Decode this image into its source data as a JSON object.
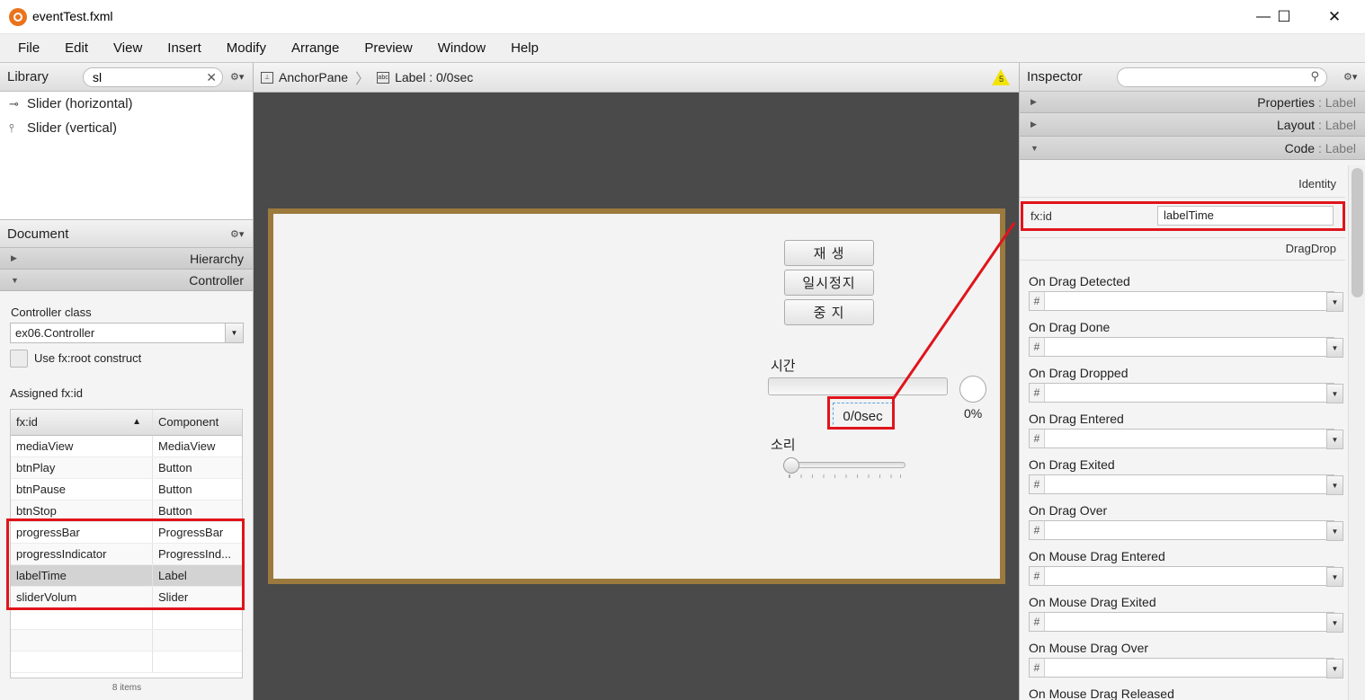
{
  "window": {
    "title": "eventTest.fxml",
    "minimize": "—",
    "maximize": "☐",
    "close": "✕"
  },
  "menu": [
    "File",
    "Edit",
    "View",
    "Insert",
    "Modify",
    "Arrange",
    "Preview",
    "Window",
    "Help"
  ],
  "library": {
    "title": "Library",
    "search_value": "sl",
    "items": [
      {
        "icon": "⊸",
        "label": "Slider  (horizontal)"
      },
      {
        "icon": "⫯",
        "label": "Slider  (vertical)"
      }
    ]
  },
  "document": {
    "title": "Document",
    "sections": {
      "hierarchy": "Hierarchy",
      "controller": "Controller"
    },
    "controller_class_label": "Controller class",
    "controller_class_value": "ex06.Controller",
    "use_root_label": "Use fx:root construct",
    "assigned_label": "Assigned fx:id",
    "columns": [
      "fx:id",
      "Component"
    ],
    "rows": [
      {
        "fxid": "mediaView",
        "component": "MediaView"
      },
      {
        "fxid": "btnPlay",
        "component": "Button"
      },
      {
        "fxid": "btnPause",
        "component": "Button"
      },
      {
        "fxid": "btnStop",
        "component": "Button"
      },
      {
        "fxid": "progressBar",
        "component": "ProgressBar"
      },
      {
        "fxid": "progressIndicator",
        "component": "ProgressInd..."
      },
      {
        "fxid": "labelTime",
        "component": "Label"
      },
      {
        "fxid": "sliderVolum",
        "component": "Slider"
      }
    ],
    "count": "8 items"
  },
  "breadcrumb": {
    "root": "AnchorPane",
    "current": "Label : 0/0sec",
    "warning_count": "5"
  },
  "canvas": {
    "btn_play": "재    생",
    "btn_pause": "일시정지",
    "btn_stop": "중    지",
    "time_label": "시간",
    "time_value": "0/0sec",
    "indicator_percent": "0%",
    "volume_label": "소리",
    "progress_value": 0,
    "volume_value": 0
  },
  "inspector": {
    "title": "Inspector",
    "sections": [
      {
        "name": "Properties",
        "suffix": " : Label"
      },
      {
        "name": "Layout",
        "suffix": " : Label"
      },
      {
        "name": "Code",
        "suffix": " : Label"
      }
    ],
    "identity_header": "Identity",
    "fxid_label": "fx:id",
    "fxid_value": "labelTime",
    "dragdrop_header": "DragDrop",
    "handlers": [
      "On Drag Detected",
      "On Drag Done",
      "On Drag Dropped",
      "On Drag Entered",
      "On Drag Exited",
      "On Drag Over",
      "On Mouse Drag Entered",
      "On Mouse Drag Exited",
      "On Mouse Drag Over",
      "On Mouse Drag Released"
    ]
  },
  "colors": {
    "highlight": "#e0141b",
    "canvas_border": "#9c7a3e",
    "workspace": "#4a4a4a",
    "app_icon": "#e9731c"
  }
}
